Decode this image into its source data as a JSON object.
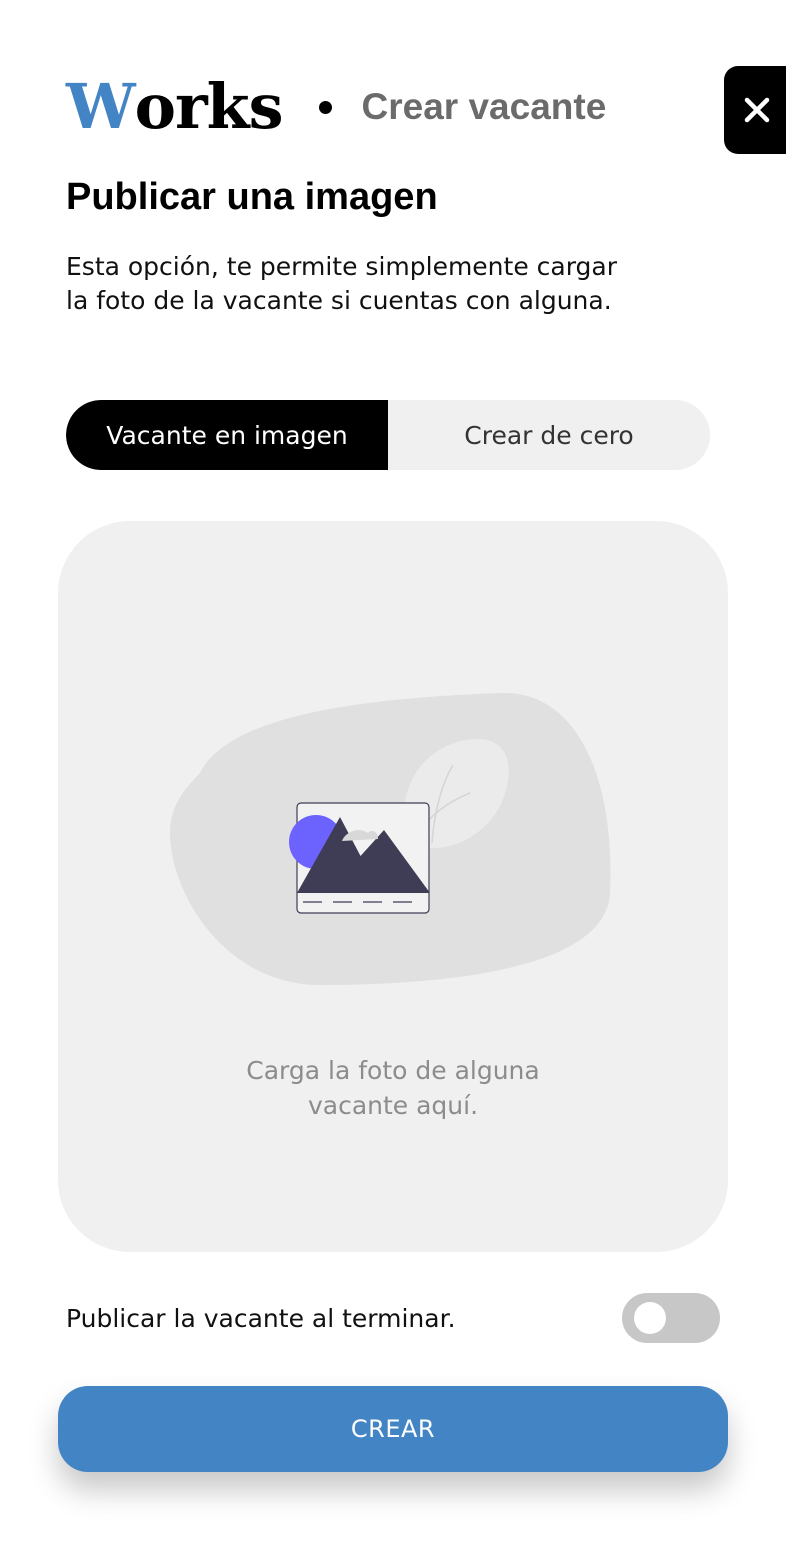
{
  "header": {
    "logo_first": "W",
    "logo_rest": "orks",
    "section_title": "Crear vacante"
  },
  "page": {
    "title": "Publicar una imagen",
    "description": "Esta opción, te permite simplemente cargar la foto de la vacante si cuentas con alguna."
  },
  "tabs": [
    {
      "label": "Vacante en imagen",
      "active": true
    },
    {
      "label": "Crear de cero",
      "active": false
    }
  ],
  "upload": {
    "text_line1": "Carga la foto de alguna",
    "text_line2": "vacante aquí.",
    "icon": "image-placeholder-icon"
  },
  "publish": {
    "label": "Publicar la vacante al terminar.",
    "toggle_on": false
  },
  "actions": {
    "create_label": "CREAR",
    "close_icon": "close-icon"
  },
  "colors": {
    "brand_blue": "#4284c4",
    "accent_purple": "#6c63ff",
    "dark": "#3f3d56"
  }
}
